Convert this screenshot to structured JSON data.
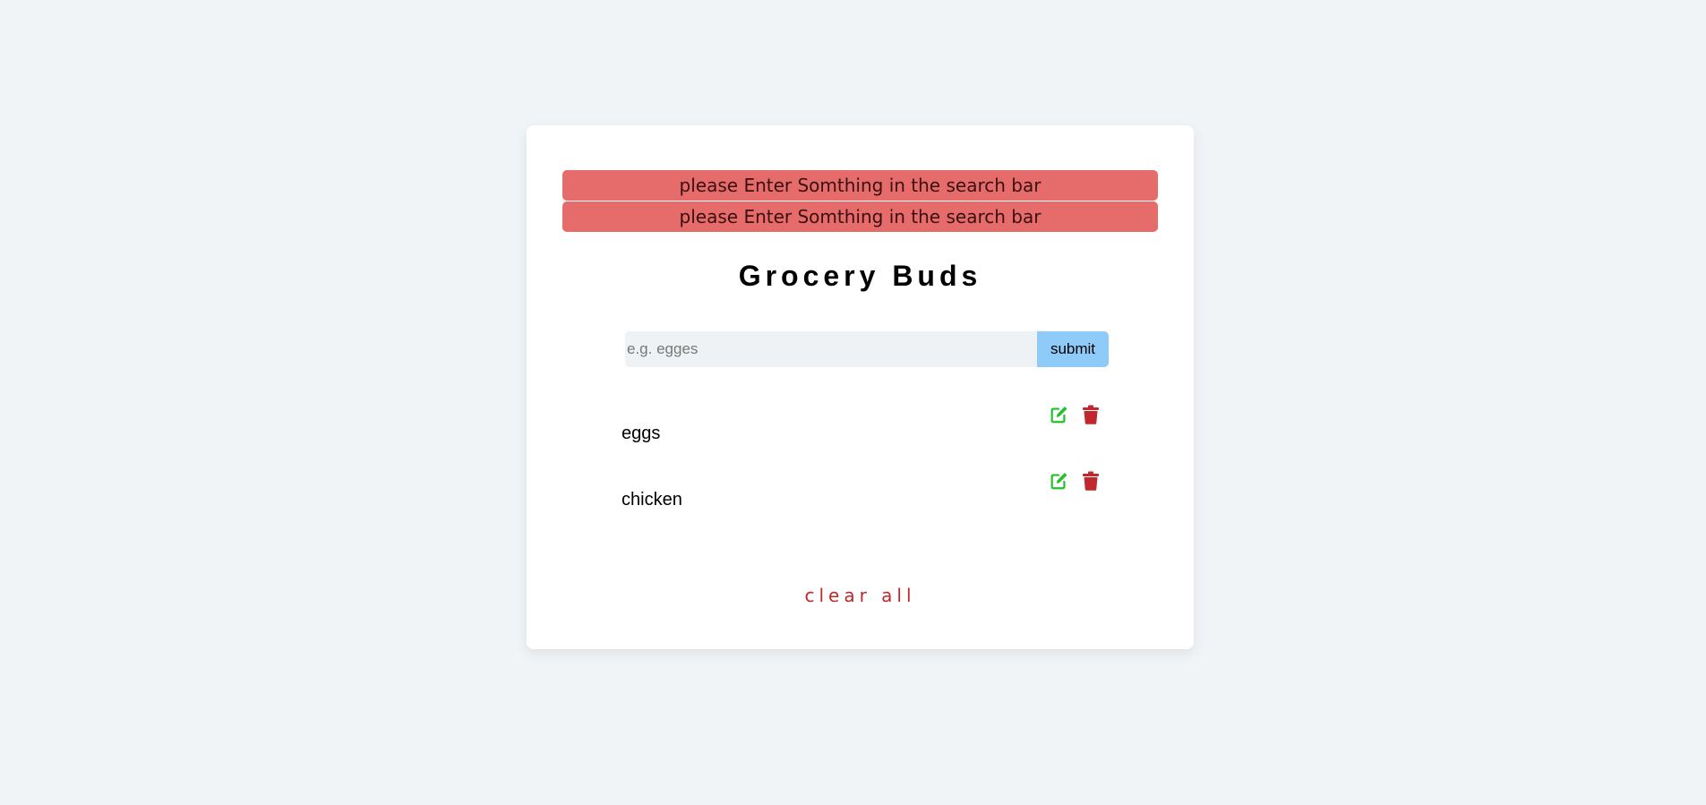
{
  "alerts": [
    {
      "text": "please Enter Somthing in the search bar"
    },
    {
      "text": "please Enter Somthing in the search bar"
    }
  ],
  "title": "Grocery Buds",
  "form": {
    "placeholder": "e.g. egges",
    "value": "",
    "submit_label": "submit"
  },
  "items": [
    {
      "name": "eggs",
      "edit_icon": "edit-icon",
      "delete_icon": "trash-icon"
    },
    {
      "name": "chicken",
      "edit_icon": "edit-icon",
      "delete_icon": "trash-icon"
    }
  ],
  "clear_all_label": "clear all",
  "colors": {
    "alert_bg": "#e66b6b",
    "submit_bg": "#8ecbf8",
    "edit": "#22c12b",
    "delete": "#c0282d",
    "clear": "#c0282d"
  }
}
